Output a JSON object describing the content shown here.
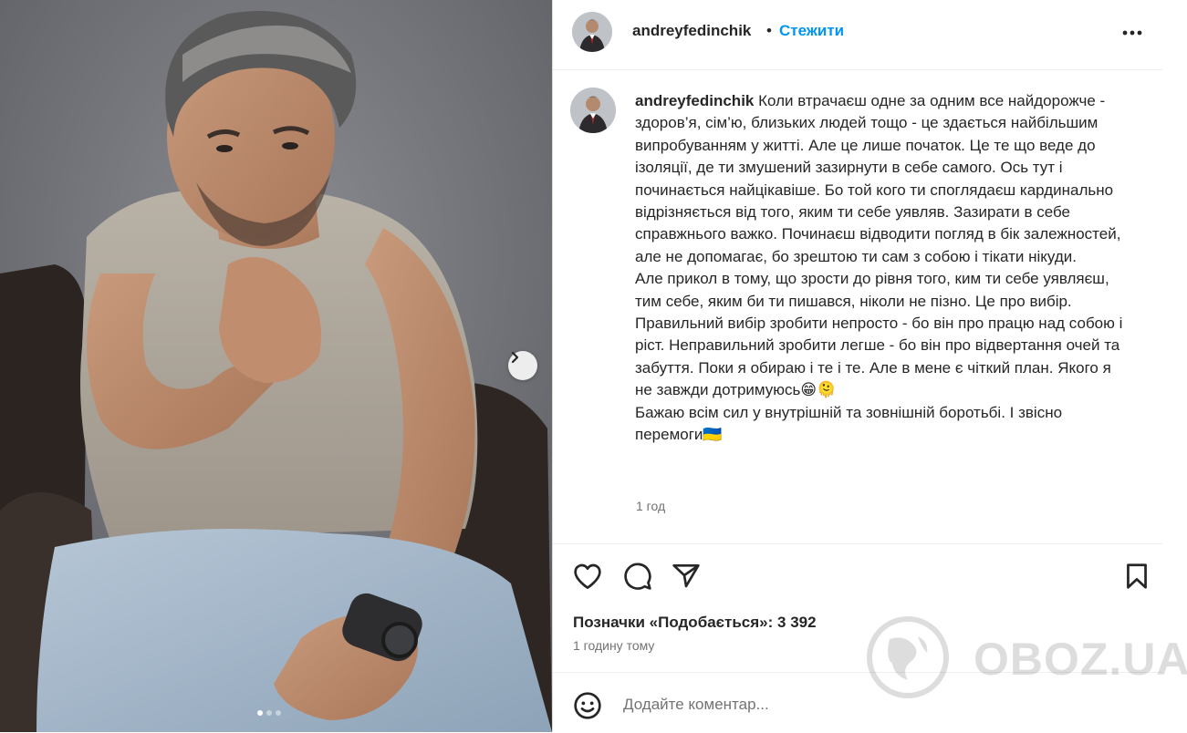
{
  "post": {
    "username": "andreyfedinchik",
    "separator": "•",
    "follow_label": "Стежити",
    "caption_paragraphs": [
      "Коли втрачаєш одне за одним все найдорожче - здоров’я, сім’ю, близьких людей тощо - це здається найбільшим випробуванням у житті. Але це лише початок. Це те що веде до ізоляції, де ти змушений зазирнути в себе самого. Ось тут і починається найцікавіше. Бо той кого ти споглядаєш кардинально відрізняється від того, яким ти себе уявляв. Зазирати в себе справжнього важко. Починаєш відводити погляд в бік залежностей, але не допомагає, бо зрештою ти сам з собою і тікати нікуди.",
      "Але прикол в тому, що зрости до рівня того, ким ти себе уявляєш, тим себе, яким би ти пишався, ніколи не пізно. Це про вибір. Правильний вибір зробити непросто - бо він про працю над собою і ріст. Неправильний зробити легше - бо він про відвертання очей та забуття. Поки я обираю і те і те. Але в мене є чіткий план. Якого я не завжди дотримуюсь😁🫠",
      "Бажаю всім сил у внутрішній та зовнішній боротьбі. І звісно перемоги🇺🇦"
    ],
    "caption_time": "1 год",
    "likes_text": "Позначки «Подобається»: 3 392",
    "posted_ago": "1 годину тому",
    "comment_placeholder": "Додайте коментар...",
    "carousel": {
      "slides": 3,
      "active_index": 0
    }
  },
  "icons": {
    "more": "more-horizontal-icon",
    "like": "heart-icon",
    "comment": "comment-bubble-icon",
    "share": "send-paper-plane-icon",
    "save": "bookmark-icon",
    "emoji": "smiley-icon",
    "next": "chevron-right-icon"
  },
  "watermark": {
    "text": "OBOZ.UA"
  },
  "colors": {
    "accent": "#0095f6",
    "text": "#262626",
    "muted": "#737373",
    "border": "#dbdbdb"
  }
}
